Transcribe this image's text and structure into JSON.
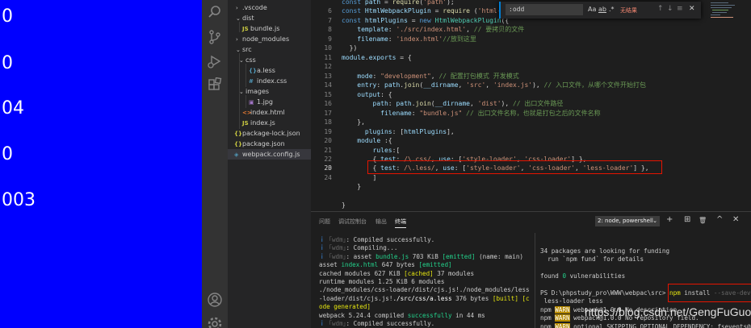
{
  "preview": {
    "lines": [
      "0",
      "0",
      "04",
      "0",
      "003"
    ]
  },
  "explorer": {
    "items": [
      {
        "label": ".vscode",
        "type": "folder",
        "state": "collapsed",
        "depth": 0
      },
      {
        "label": "dist",
        "type": "folder",
        "state": "expanded",
        "depth": 0
      },
      {
        "label": "bundle.js",
        "type": "js",
        "depth": 1
      },
      {
        "label": "node_modules",
        "type": "folder",
        "state": "collapsed",
        "depth": 0
      },
      {
        "label": "src",
        "type": "folder",
        "state": "expanded",
        "depth": 0
      },
      {
        "label": "css",
        "type": "folder",
        "state": "expanded",
        "depth": 1
      },
      {
        "label": "a.less",
        "type": "less",
        "depth": 2
      },
      {
        "label": "index.css",
        "type": "css",
        "depth": 2
      },
      {
        "label": "images",
        "type": "folder",
        "state": "expanded",
        "depth": 1
      },
      {
        "label": "1.jpg",
        "type": "image",
        "depth": 2
      },
      {
        "label": "index.html",
        "type": "html",
        "depth": 1
      },
      {
        "label": "index.js",
        "type": "js",
        "depth": 1
      },
      {
        "label": "package-lock.json",
        "type": "json",
        "depth": 0
      },
      {
        "label": "package.json",
        "type": "json",
        "depth": 0
      },
      {
        "label": "webpack.config.js",
        "type": "webpack",
        "depth": 0,
        "selected": true
      }
    ]
  },
  "find": {
    "value": ":odd",
    "match_case": "Aa",
    "whole_word": "ab",
    "regex": ".*",
    "result": "无结果",
    "prev": "↑",
    "next": "↓",
    "selection": "≡",
    "close": "✕"
  },
  "editor": {
    "line_numbers": [
      "",
      "6",
      "7",
      "8",
      "9",
      "10",
      "11",
      "12",
      "13",
      "14",
      "15",
      "16",
      "17",
      "18",
      "19",
      "20",
      "21",
      "22",
      "23",
      "24"
    ],
    "current_line": "20"
  },
  "panel": {
    "tabs": [
      "问题",
      "调试控制台",
      "输出",
      "终端"
    ],
    "active_tab": "终端",
    "terminal_select": "2: node, powershell",
    "add": "+",
    "split": "⊞",
    "trash": "🗑",
    "maximize": "^",
    "close": "✕"
  },
  "watermark": "https://blog.csdn.net/GengFuGuo",
  "colors": {
    "preview_bg": "#0000ff",
    "highlight_border": "#e51400",
    "accent": "#007fd4"
  }
}
